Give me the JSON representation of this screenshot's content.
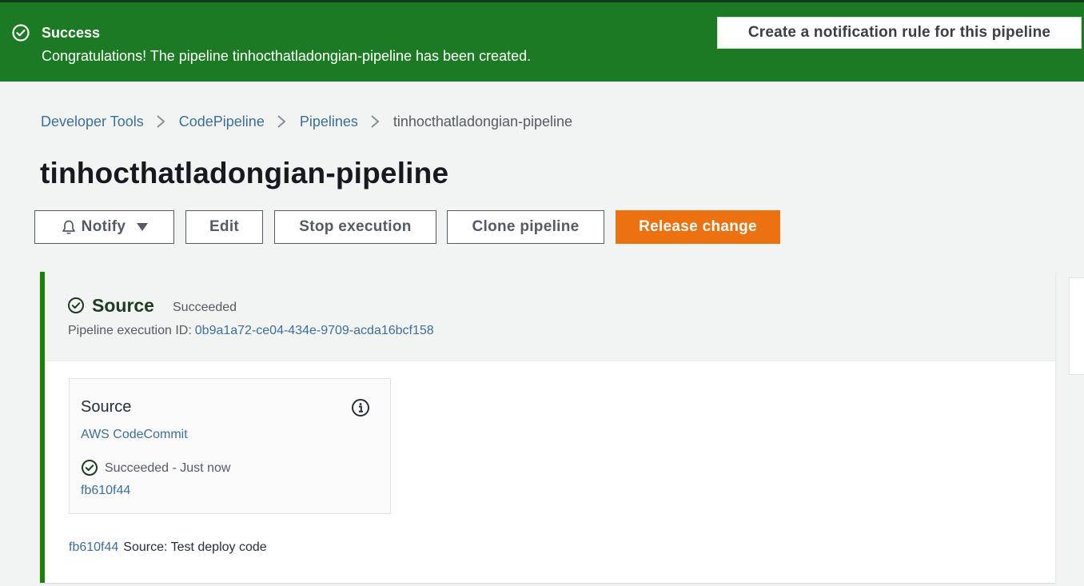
{
  "flash": {
    "title": "Success",
    "message": "Congratulations! The pipeline tinhocthatladongian-pipeline has been created.",
    "button_label": "Create a notification rule for this pipeline",
    "color": "#1d7a24"
  },
  "breadcrumb": {
    "items": [
      "Developer Tools",
      "CodePipeline",
      "Pipelines"
    ],
    "current": "tinhocthatladongian-pipeline"
  },
  "page": {
    "title": "tinhocthatladongian-pipeline"
  },
  "actions": {
    "notify_label": "Notify",
    "edit_label": "Edit",
    "stop_label": "Stop execution",
    "clone_label": "Clone pipeline",
    "release_label": "Release change",
    "release_color": "#ec7211"
  },
  "stage": {
    "name": "Source",
    "status": "Succeeded",
    "execution_label": "Pipeline execution ID:",
    "execution_id": "0b9a1a72-ce04-434e-9709-acda16bcf158",
    "accent_color": "#1d8102",
    "action": {
      "name": "Source",
      "provider": "AWS CodeCommit",
      "status": "Succeeded",
      "time": "Just now",
      "commit": "fb610f44"
    },
    "footer": {
      "commit": "fb610f44",
      "message": "Source: Test deploy code"
    }
  }
}
